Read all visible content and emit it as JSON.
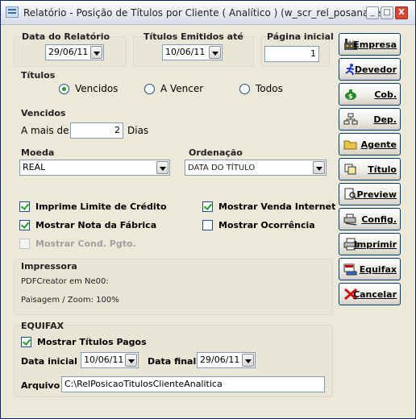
{
  "window": {
    "title": "Relatório - Posição de Títulos por Cliente ( Analítico ) (w_scr_rel_posanadev)",
    "minimize": "_",
    "maximize": "□",
    "close": "X"
  },
  "dates": {
    "report_date_label": "Data do Relatório",
    "report_date_value": "29/06/11",
    "issued_until_label": "Títulos Emitidos até",
    "issued_until_value": "10/06/11",
    "start_page_label": "Página inicial",
    "start_page_value": "1"
  },
  "titulos": {
    "label": "Títulos",
    "options": [
      "Vencidos",
      "A Vencer",
      "Todos"
    ],
    "selected": "Vencidos"
  },
  "vencidos": {
    "label": "Vencidos",
    "prefix": "A mais de",
    "value": "2",
    "suffix": "Dias"
  },
  "moeda": {
    "label": "Moeda",
    "value": "REAL"
  },
  "ordenacao": {
    "label": "Ordenação",
    "value": "DATA DO TÍTULO"
  },
  "checks": {
    "imprime_limite": "Imprime Limite de Crédito",
    "mostrar_venda_internet": "Mostrar Venda Internet",
    "mostrar_nota_fabrica": "Mostrar Nota da Fábrica",
    "mostrar_ocorrencia": "Mostrar Ocorrência",
    "mostrar_cond_pgto": "Mostrar Cond. Pgto."
  },
  "impressora": {
    "label": "Impressora",
    "printer": "PDFCreator em Ne00:",
    "layout": "Paisagem / Zoom: 100%"
  },
  "equifax": {
    "label": "EQUIFAX",
    "mostrar_pagos": "Mostrar Títulos Pagos",
    "start_label": "Data inicial :",
    "start_value": "10/06/11",
    "end_label": "Data final :",
    "end_value": "29/06/11",
    "file_label": "Arquivo :",
    "file_value": "C:\\RelPosicaoTitulosClienteAnalitica"
  },
  "side_buttons": [
    {
      "label": "Empresa",
      "icon": "factory-icon"
    },
    {
      "label": "Devedor",
      "icon": "runner-icon"
    },
    {
      "label": "Cob.",
      "icon": "money-bag-icon"
    },
    {
      "label": "Dep.",
      "icon": "org-chart-icon"
    },
    {
      "label": "Agente",
      "icon": "folder-icon"
    },
    {
      "label": "Título",
      "icon": "documents-icon"
    },
    {
      "label": "Preview",
      "icon": "preview-icon"
    },
    {
      "label": "Config.",
      "icon": "printer-config-icon"
    },
    {
      "label": "Imprimir",
      "icon": "printer-icon"
    },
    {
      "label": "Equifax",
      "icon": "equifax-icon"
    },
    {
      "label": "Cancelar",
      "icon": "cancel-icon"
    }
  ]
}
